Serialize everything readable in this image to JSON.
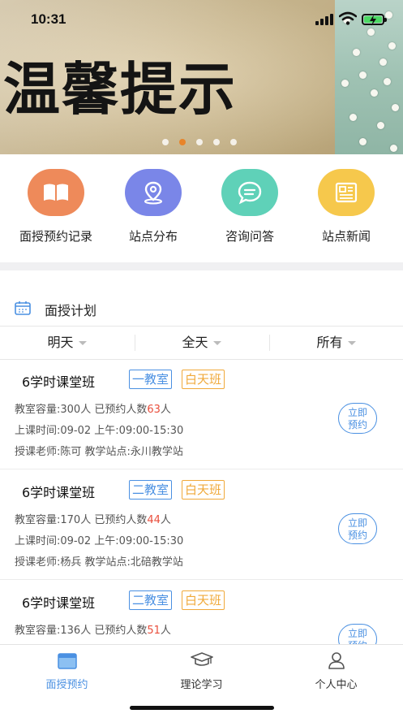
{
  "status_bar": {
    "time": "10:31"
  },
  "banner": {
    "title": "温馨提示",
    "slide_count": 5,
    "active_slide": 2
  },
  "quick_menu": [
    {
      "label": "面授预约记录",
      "icon": "book-icon",
      "color": "#ee8a5a"
    },
    {
      "label": "站点分布",
      "icon": "location-pin-icon",
      "color": "#7a86e8"
    },
    {
      "label": "咨询问答",
      "icon": "chat-bubble-icon",
      "color": "#5fd1b8"
    },
    {
      "label": "站点新闻",
      "icon": "newspaper-icon",
      "color": "#f6c84c"
    }
  ],
  "plan": {
    "title": "面授计划",
    "filters": [
      "明天",
      "全天",
      "所有"
    ]
  },
  "classes": [
    {
      "name": "6学时课堂班",
      "room": "一教室",
      "period": "白天班",
      "capacity": "教室容量:300人",
      "booked_prefix": "已预约人数",
      "booked": "63",
      "booked_suffix": "人",
      "time": "上课时间:09-02  上午:09:00-15:30",
      "teacher": "授课老师:陈可  教学站点:永川教学站",
      "book_label_1": "立即",
      "book_label_2": "预约"
    },
    {
      "name": "6学时课堂班",
      "room": "二教室",
      "period": "白天班",
      "capacity": "教室容量:170人",
      "booked_prefix": "已预约人数",
      "booked": "44",
      "booked_suffix": "人",
      "time": "上课时间:09-02  上午:09:00-15:30",
      "teacher": "授课老师:杨兵  教学站点:北碚教学站",
      "book_label_1": "立即",
      "book_label_2": "预约"
    },
    {
      "name": "6学时课堂班",
      "room": "二教室",
      "period": "白天班",
      "capacity": "教室容量:136人",
      "booked_prefix": "已预约人数",
      "booked": "51",
      "booked_suffix": "人",
      "time": "",
      "teacher": "",
      "book_label_1": "立即",
      "book_label_2": "预约"
    }
  ],
  "tabbar": [
    {
      "label": "面授预约",
      "icon": "calendar-icon",
      "active": true
    },
    {
      "label": "理论学习",
      "icon": "graduation-cap-icon",
      "active": false
    },
    {
      "label": "个人中心",
      "icon": "person-icon",
      "active": false
    }
  ],
  "colors": {
    "accent": "#4a90e2",
    "tag_orange": "#f0a93a",
    "count_red": "#e94e3c"
  }
}
